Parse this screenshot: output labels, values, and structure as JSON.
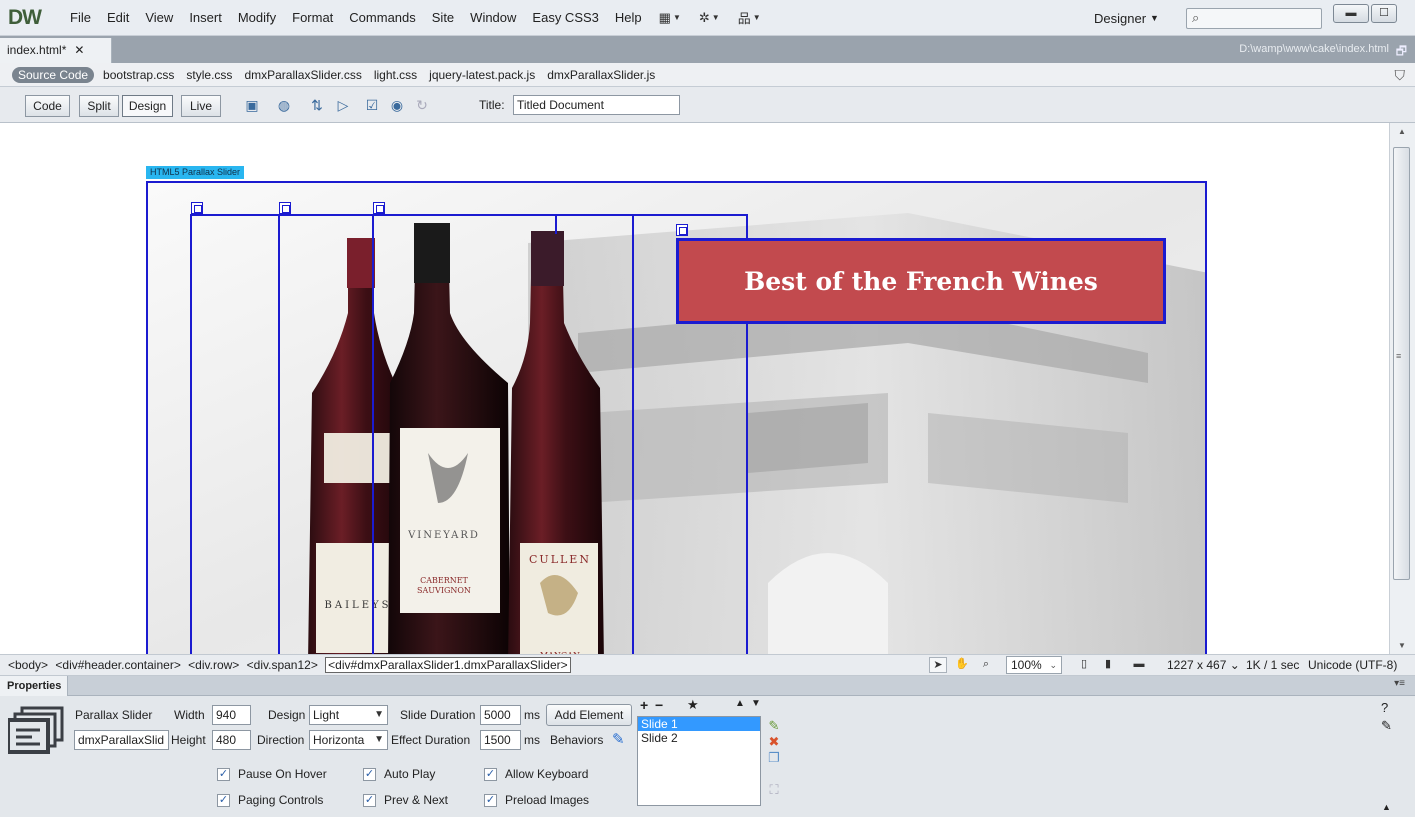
{
  "app": {
    "logo": "DW",
    "menu": [
      "File",
      "Edit",
      "View",
      "Insert",
      "Modify",
      "Format",
      "Commands",
      "Site",
      "Window",
      "Easy CSS3",
      "Help"
    ],
    "icons": [
      "layout-icon",
      "gear-icon",
      "site-icon"
    ],
    "workspace": "Designer",
    "search_placeholder": ""
  },
  "document": {
    "tab_label": "index.html*",
    "path": "D:\\wamp\\www\\cake\\index.html",
    "source_code_label": "Source Code",
    "related_files": [
      "bootstrap.css",
      "style.css",
      "dmxParallaxSlider.css",
      "light.css",
      "jquery-latest.pack.js",
      "dmxParallaxSlider.js"
    ]
  },
  "toolbar": {
    "views": [
      "Code",
      "Split",
      "Design",
      "Live"
    ],
    "active_view": "Design",
    "title_label": "Title:",
    "title_value": "Titled Document"
  },
  "canvas": {
    "slider_tag": "HTML5 Parallax Slider",
    "headline": "Best of the French Wines",
    "headline_color": "#c24a4e",
    "outline_color": "#1b1bd0"
  },
  "status": {
    "tag_path": [
      "<body>",
      "<div#header.container>",
      "<div.row>",
      "<div.span12>"
    ],
    "selected_tag": "<div#dmxParallaxSlider1.dmxParallaxSlider>",
    "zoom": "100%",
    "dimensions": "1227 x 467",
    "speed": "1K / 1 sec",
    "encoding": "Unicode (UTF-8)"
  },
  "properties": {
    "header": "Properties",
    "element_type": "Parallax Slider",
    "element_id": "dmxParallaxSlid",
    "width_label": "Width",
    "width": "940",
    "height_label": "Height",
    "height": "480",
    "design_label": "Design",
    "design": "Light",
    "direction_label": "Direction",
    "direction": "Horizonta",
    "slide_duration_label": "Slide Duration",
    "slide_duration": "5000",
    "effect_duration_label": "Effect Duration",
    "effect_duration": "1500",
    "ms": "ms",
    "add_element": "Add Element",
    "behaviors": "Behaviors",
    "checkboxes": {
      "pause_on_hover": "Pause On Hover",
      "auto_play": "Auto Play",
      "allow_keyboard": "Allow Keyboard",
      "paging_controls": "Paging Controls",
      "prev_next": "Prev & Next",
      "preload_images": "Preload Images"
    },
    "list_controls": [
      "+",
      "−",
      "★",
      "▲",
      "▼"
    ],
    "slides": [
      "Slide 1",
      "Slide 2"
    ],
    "selected_slide": "Slide 1"
  }
}
